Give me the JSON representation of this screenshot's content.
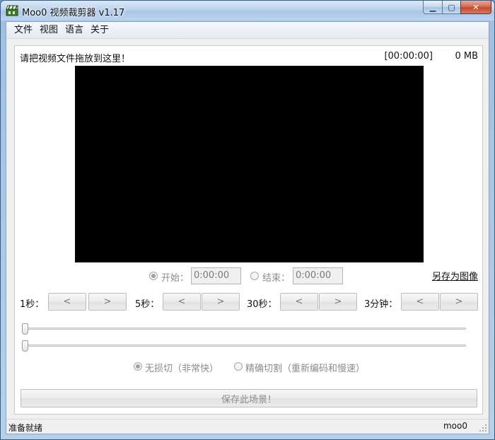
{
  "window": {
    "title": "Moo0 视频裁剪器 v1.17",
    "icon": "film-clapper-icon"
  },
  "menu": [
    "文件",
    "视图",
    "语言",
    "关于"
  ],
  "panel": {
    "drop_hint": "请把视频文件拖放到这里！",
    "duration": "[00:00:00]",
    "file_size": "0 MB"
  },
  "range": {
    "start_label": "开始：",
    "start_value": "0:00:00",
    "end_label": "结束：",
    "end_value": "0:00:00",
    "save_image_link": "另存为图像"
  },
  "steps": [
    {
      "label": "1秒：",
      "prev": "<",
      "next": ">"
    },
    {
      "label": "5秒：",
      "prev": "<",
      "next": ">"
    },
    {
      "label": "30秒：",
      "prev": "<",
      "next": ">"
    },
    {
      "label": "3分钟：",
      "prev": "<",
      "next": ">"
    }
  ],
  "sliders": {
    "start_position": 0,
    "end_position": 0
  },
  "modes": {
    "lossless_label": "无损切（非常快）",
    "precise_label": "精确切割（重新编码和慢速）",
    "selected": "lossless"
  },
  "actions": {
    "save_scene": "保存此场景！"
  },
  "status": {
    "text": "准备就绪",
    "brand": "moo0"
  }
}
